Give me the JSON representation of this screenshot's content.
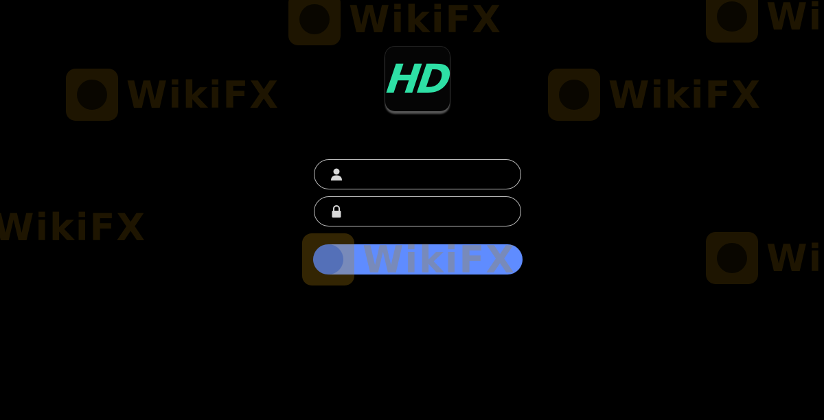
{
  "logo": {
    "text": "HD",
    "color": "#2ee0a5"
  },
  "form": {
    "username": {
      "icon": "user-icon",
      "value": "",
      "placeholder": ""
    },
    "password": {
      "icon": "lock-icon",
      "value": "",
      "placeholder": ""
    },
    "submit": {
      "label": "",
      "color": "#5f8cff"
    }
  },
  "watermark": {
    "text": "WikiFX"
  }
}
